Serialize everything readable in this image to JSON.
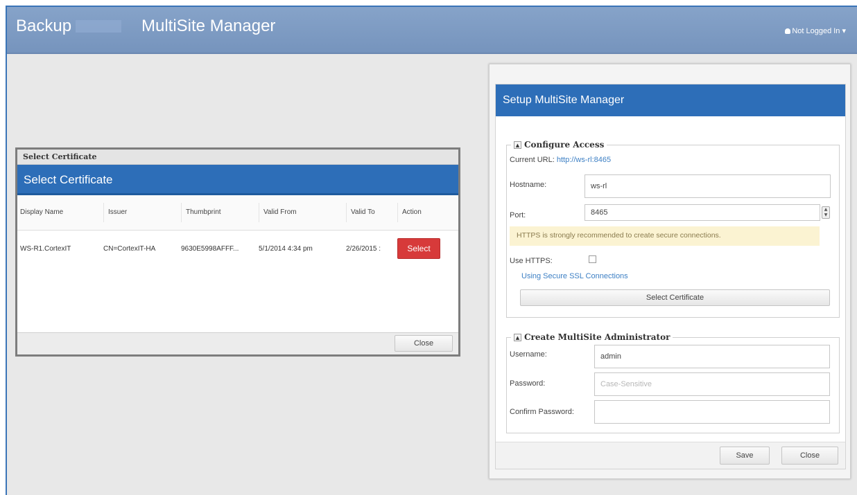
{
  "header": {
    "brand": "Backup",
    "app_title": "MultiSite Manager",
    "user_menu": "Not Logged In ▾"
  },
  "cert_dialog": {
    "window_title": "Select Certificate",
    "header": "Select Certificate",
    "columns": [
      "Display Name",
      "Issuer",
      "Thumbprint",
      "Valid From",
      "Valid To",
      "Action"
    ],
    "rows": [
      {
        "display_name": "WS-R1.CortexIT",
        "issuer": "CN=CortexIT-HA",
        "thumbprint": "9630E5998AFFF...",
        "valid_from": "5/1/2014 4:34 pm",
        "valid_to": "2/26/2015 :",
        "action": "Select"
      }
    ],
    "close_label": "Close"
  },
  "setup": {
    "header": "Setup MultiSite Manager",
    "configure_access": {
      "legend": "Configure Access",
      "current_url_label": "Current URL:",
      "current_url": "http://ws-rl:8465",
      "hostname_label": "Hostname:",
      "hostname_value": "ws-rl",
      "port_label": "Port:",
      "port_value": "8465",
      "https_warning": "HTTPS is strongly recommended to create secure connections.",
      "use_https_label": "Use HTTPS:",
      "ssl_link": "Using Secure SSL Connections",
      "select_cert_label": "Select Certificate"
    },
    "create_admin": {
      "legend": "Create MultiSite Administrator",
      "username_label": "Username:",
      "username_value": "admin",
      "password_label": "Password:",
      "password_placeholder": "Case-Sensitive",
      "confirm_label": "Confirm Password:"
    },
    "save_label": "Save",
    "close_label": "Close"
  }
}
